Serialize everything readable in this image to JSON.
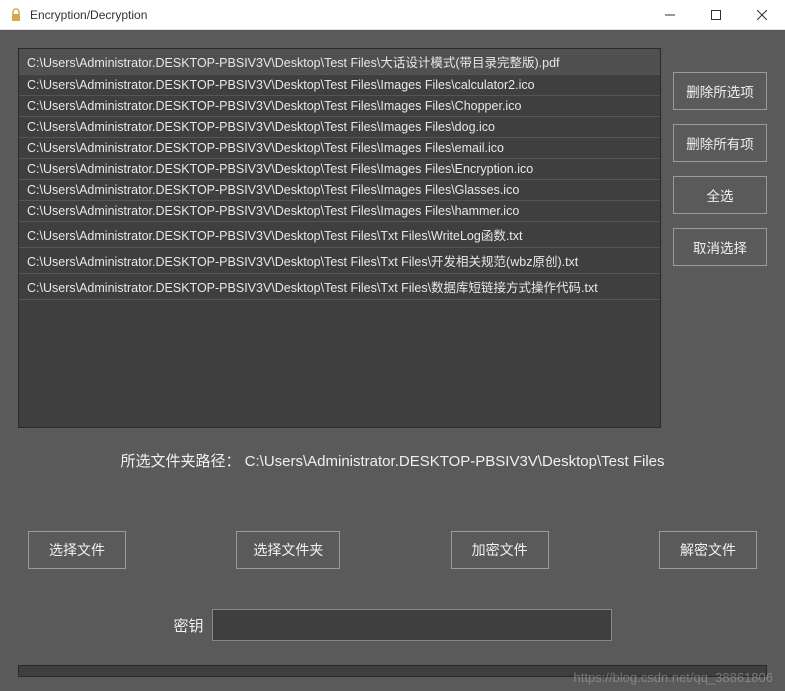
{
  "window": {
    "title": "Encryption/Decryption"
  },
  "file_list": {
    "items": [
      "C:\\Users\\Administrator.DESKTOP-PBSIV3V\\Desktop\\Test Files\\大话设计模式(带目录完整版).pdf",
      "C:\\Users\\Administrator.DESKTOP-PBSIV3V\\Desktop\\Test Files\\Images Files\\calculator2.ico",
      "C:\\Users\\Administrator.DESKTOP-PBSIV3V\\Desktop\\Test Files\\Images Files\\Chopper.ico",
      "C:\\Users\\Administrator.DESKTOP-PBSIV3V\\Desktop\\Test Files\\Images Files\\dog.ico",
      "C:\\Users\\Administrator.DESKTOP-PBSIV3V\\Desktop\\Test Files\\Images Files\\email.ico",
      "C:\\Users\\Administrator.DESKTOP-PBSIV3V\\Desktop\\Test Files\\Images Files\\Encryption.ico",
      "C:\\Users\\Administrator.DESKTOP-PBSIV3V\\Desktop\\Test Files\\Images Files\\Glasses.ico",
      "C:\\Users\\Administrator.DESKTOP-PBSIV3V\\Desktop\\Test Files\\Images Files\\hammer.ico",
      "C:\\Users\\Administrator.DESKTOP-PBSIV3V\\Desktop\\Test Files\\Txt Files\\WriteLog函数.txt",
      "C:\\Users\\Administrator.DESKTOP-PBSIV3V\\Desktop\\Test Files\\Txt Files\\开发相关规范(wbz原创).txt",
      "C:\\Users\\Administrator.DESKTOP-PBSIV3V\\Desktop\\Test Files\\Txt Files\\数据库短链接方式操作代码.txt"
    ]
  },
  "side": {
    "delete_selected": "删除所选项",
    "delete_all": "删除所有项",
    "select_all": "全选",
    "deselect": "取消选择"
  },
  "path": {
    "label": "所选文件夹路径：",
    "value": "C:\\Users\\Administrator.DESKTOP-PBSIV3V\\Desktop\\Test Files"
  },
  "actions": {
    "choose_file": "选择文件",
    "choose_folder": "选择文件夹",
    "encrypt": "加密文件",
    "decrypt": "解密文件"
  },
  "key": {
    "label": "密钥",
    "value": ""
  },
  "watermark": "https://blog.csdn.net/qq_38861806"
}
